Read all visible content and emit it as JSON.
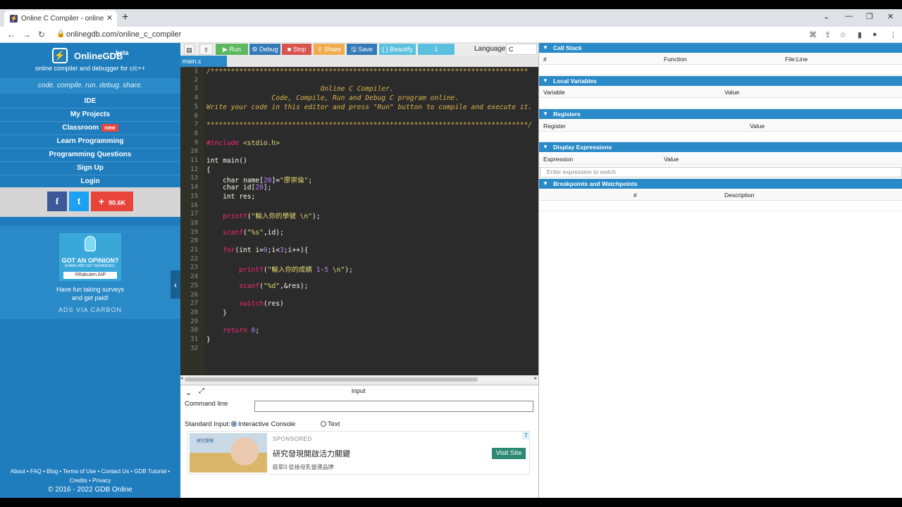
{
  "browser": {
    "tab_title": "Online C Compiler - online edi",
    "tab_favicon": "⚡",
    "new_tab": "+",
    "url": "onlinegdb.com/online_c_compiler"
  },
  "sidebar": {
    "brand_name": "OnlineGDB",
    "brand_beta": "beta",
    "brand_subtitle": "online compiler and debugger for c/c++",
    "motto": "code. compile. run. debug. share.",
    "menu": [
      {
        "label": "IDE"
      },
      {
        "label": "My Projects"
      },
      {
        "label": "Classroom",
        "badge": "new"
      },
      {
        "label": "Learn Programming"
      },
      {
        "label": "Programming Questions"
      },
      {
        "label": "Sign Up"
      },
      {
        "label": "Login"
      }
    ],
    "social": {
      "facebook": "f",
      "twitter": "t",
      "share_count": "90.6K",
      "share_plus": "+"
    },
    "ad": {
      "image_title": "GOT AN OPINION?",
      "image_subtitle": "SHARE AND GET REWARDED.",
      "image_brand": "®Rakuten AIP",
      "caption_line1": "Have fun taking surveys",
      "caption_line2": "and get paid!",
      "via": "ADS VIA CARBON"
    },
    "footer": {
      "links_line1": "About • FAQ • Blog • Terms of Use • Contact Us • GDB Tutorial •",
      "links_line2": "Credits • Privacy",
      "copyright": "© 2016 - 2022 GDB Online"
    }
  },
  "toolbar": {
    "run": "▶ Run",
    "debug": "⚙ Debug",
    "stop": "■ Stop",
    "share": "⇪ Share",
    "save": "🖫 Save",
    "beautify": "{ } Beautify",
    "download": "⇩",
    "language_label": "Language",
    "language_value": "C"
  },
  "editor": {
    "file_tab": "main.c",
    "lines": [
      "/******************************************************************************",
      "",
      "                            Online C Compiler.",
      "                Code, Compile, Run and Debug C program online.",
      "Write your code in this editor and press \"Run\" button to compile and execute it.",
      "",
      "*******************************************************************************/",
      "",
      "#include <stdio.h>",
      "",
      "int main()",
      "{",
      "    char name[20]=\"廖崇倫\";",
      "    char id[20];",
      "    int res;",
      "",
      "    printf(\"輸入你的學號 \\n\");",
      "",
      "    scanf(\"%s\",id);",
      "",
      "    for(int i=0;i<3;i++){",
      "",
      "        printf(\"輸入你的成績 1-5 \\n\");",
      "",
      "        scanf(\"%d\",&res);",
      "",
      "        switch(res)",
      "    }",
      "",
      "    return 0;",
      "}",
      ""
    ]
  },
  "input_pane": {
    "title": "input",
    "command_line_label": "Command line",
    "standard_input_label": "Standard Input:",
    "option_console": "Interactive Console",
    "option_text": "Text",
    "sponsor": {
      "tag": "SPONSORED",
      "headline": "研究發現開啟活力關鍵",
      "description": "歐耶3 從接母乳營運品牌",
      "button": "Visit Site",
      "ad_marker": "T"
    }
  },
  "debug_panel": {
    "call_stack": {
      "title": "Call Stack",
      "columns": [
        "#",
        "Function",
        "File:Line"
      ]
    },
    "local_variables": {
      "title": "Local Variables",
      "columns": [
        "Variable",
        "Value"
      ]
    },
    "registers": {
      "title": "Registers",
      "columns": [
        "Register",
        "Value"
      ]
    },
    "display_expressions": {
      "title": "Display Expressions",
      "columns": [
        "Expression",
        "Value"
      ],
      "placeholder": "Enter expression to watch"
    },
    "breakpoints": {
      "title": "Breakpoints and Watchpoints",
      "columns": [
        "#",
        "Description"
      ]
    }
  },
  "colors": {
    "brand_blue": "#1f7dbd",
    "run_green": "#5cb85c",
    "stop_red": "#d9534f",
    "share_orange": "#f0ad4e",
    "save_blue": "#337ab7",
    "beautify_cyan": "#5bc0de",
    "editor_bg": "#2b2b2b"
  }
}
